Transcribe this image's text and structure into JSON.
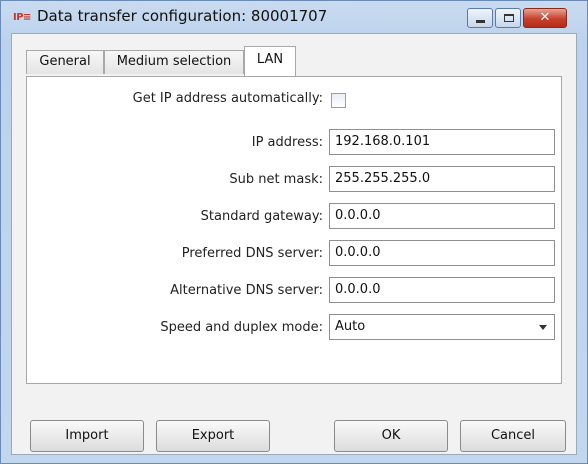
{
  "window": {
    "app_icon_text": "IP≡",
    "title": "Data transfer configuration: 80001707",
    "minimize_icon": "minimize-icon",
    "maximize_icon": "maximize-icon",
    "close_glyph": "✕"
  },
  "tabs": [
    {
      "label": "General"
    },
    {
      "label": "Medium selection"
    },
    {
      "label": "LAN"
    }
  ],
  "lan": {
    "auto_ip_label": "Get IP address automatically:",
    "auto_ip_checked": false,
    "ip_label": "IP address:",
    "ip_value": "192.168.0.101",
    "subnet_label": "Sub net mask:",
    "subnet_value": "255.255.255.0",
    "gateway_label": "Standard gateway:",
    "gateway_value": "0.0.0.0",
    "dns1_label": "Preferred DNS server:",
    "dns1_value": "0.0.0.0",
    "dns2_label": "Alternative DNS server:",
    "dns2_value": "0.0.0.0",
    "speed_label": "Speed and duplex mode:",
    "speed_value": "Auto"
  },
  "buttons": {
    "import": "Import",
    "export": "Export",
    "ok": "OK",
    "cancel": "Cancel"
  }
}
